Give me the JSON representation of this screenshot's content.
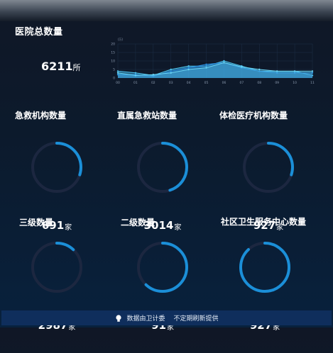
{
  "header": {
    "title": "医院总数量"
  },
  "total": {
    "value": "6211",
    "unit": "所"
  },
  "cards": [
    {
      "label": "急救机构数量",
      "value": "691",
      "unit": "家",
      "progress": 0.3
    },
    {
      "label": "直属急救站数量",
      "value": "3014",
      "unit": "家",
      "progress": 0.45
    },
    {
      "label": "体检医疗机构数量",
      "value": "927",
      "unit": "家",
      "progress": 0.3
    },
    {
      "label": "三级数量",
      "value": "2987",
      "unit": "家",
      "progress": 0.12
    },
    {
      "label": "二级数量",
      "value": "91",
      "unit": "家",
      "progress": 0.62
    },
    {
      "label": "社区卫生服务中心数量",
      "value": "927",
      "unit": "家",
      "progress": 0.88
    }
  ],
  "footer": {
    "source": "数据由卫计委",
    "note": "不定期刷新提供"
  },
  "colors": {
    "accent": "#1b8fd8",
    "track": "#1c2740"
  },
  "chart_data": {
    "type": "area",
    "y_label": "(万)",
    "x": [
      "00",
      "01",
      "02",
      "03",
      "04",
      "05",
      "06",
      "07",
      "08",
      "09",
      "10",
      "11"
    ],
    "yticks": [
      "20",
      "15",
      "10",
      "5",
      "0"
    ],
    "ylim": [
      0,
      20
    ],
    "grid": true,
    "series": [
      {
        "values": [
          4,
          3,
          1.5,
          5,
          7,
          7,
          10,
          7,
          4,
          4,
          4,
          1.5
        ]
      },
      {
        "values": [
          2,
          2,
          1,
          4,
          6,
          8,
          9,
          6,
          4,
          3,
          3,
          3
        ]
      },
      {
        "values": [
          3,
          1.5,
          2,
          3,
          5,
          6,
          9,
          6.5,
          5,
          4,
          4,
          4
        ]
      }
    ]
  }
}
